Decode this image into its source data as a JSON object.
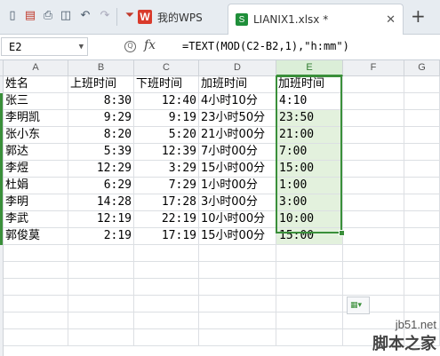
{
  "tabs": {
    "home_label": "我的WPS",
    "file_label": "LIANIX1.xlsx *"
  },
  "formula_bar": {
    "cell_ref": "E2",
    "fx_label": "fx",
    "formula": "=TEXT(MOD(C2-B2,1),\"h:mm\")"
  },
  "columns": [
    "A",
    "B",
    "C",
    "D",
    "E",
    "F",
    "G"
  ],
  "sheet": {
    "header": [
      "姓名",
      "上班时间",
      "下班时间",
      "加班时间",
      "加班时间"
    ],
    "rows": [
      [
        "张三",
        "8:30",
        "12:40",
        "4小时10分",
        "4:10"
      ],
      [
        "李明凯",
        "9:29",
        "9:19",
        "23小时50分",
        "23:50"
      ],
      [
        "张小东",
        "8:20",
        "5:20",
        "21小时00分",
        "21:00"
      ],
      [
        "郭达",
        "5:39",
        "12:39",
        "7小时00分",
        "7:00"
      ],
      [
        "李煜",
        "12:29",
        "3:29",
        "15小时00分",
        "15:00"
      ],
      [
        "杜娟",
        "6:29",
        "7:29",
        "1小时00分",
        "1:00"
      ],
      [
        "李明",
        "14:28",
        "17:28",
        "3小时00分",
        "3:00"
      ],
      [
        "李武",
        "12:19",
        "22:19",
        "10小时00分",
        "10:00"
      ],
      [
        "郭俊莫",
        "2:19",
        "17:19",
        "15小时00分",
        "15:00"
      ]
    ]
  },
  "watermark": {
    "url": "jb51.net",
    "name": "脚本之家"
  },
  "colors": {
    "selection": "#3a8f3a",
    "selected_fill": "#e3f1dd",
    "wps_red": "#d93a2b"
  }
}
